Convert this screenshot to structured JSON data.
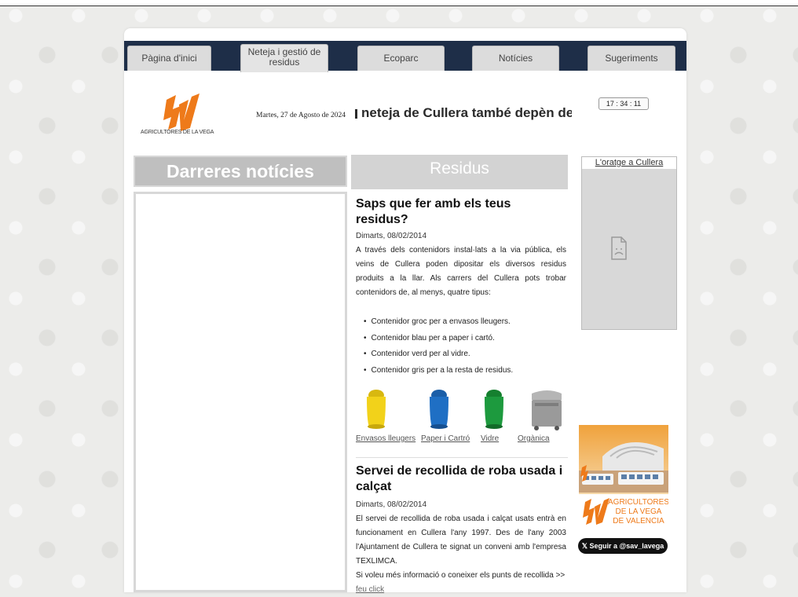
{
  "nav": {
    "tabs": [
      {
        "label": "Pàgina d'inici"
      },
      {
        "label": "Neteja i gestió de residus"
      },
      {
        "label": "Ecoparc"
      },
      {
        "label": "Notícies"
      },
      {
        "label": "Sugeriments"
      }
    ]
  },
  "header": {
    "logo_text": "AGRICULTORES DE LA VEGA",
    "date": "Martes, 27 de Agosto de 2024",
    "marquee": "neteja de  Cullera  també depèn de",
    "clock": "17 : 34 : 11"
  },
  "left": {
    "heading": "Darreres notícies"
  },
  "middle": {
    "heading": "Residus",
    "article1": {
      "title": "Saps que fer amb els teus residus?",
      "date": "Dimarts, 08/02/2014",
      "body": "A través dels contenidors  instal·lats a la via pública, els veins de Cullera poden dipositar els diversos residus produits a la llar. Als carrers del Cullera pots trobar contenidors de, al menys, quatre tipus:",
      "items": [
        "Contenidor groc per a envasos lleugers.",
        "Contenidor blau per a paper i cartó.",
        "Contenidor verd per al vidre.",
        "Contenidor gris  per a la resta de residus."
      ],
      "bin_labels": [
        "Envasos lleugers",
        "Paper i Cartró",
        "Vidre",
        "Orgànica"
      ]
    },
    "article2": {
      "title": "Servei de recollida de roba usada i calçat",
      "date": "Dimarts, 08/02/2014",
      "body": "El servei de recollida de roba usada i calçat usats entrà en funcionament en Cullera l'any 1997. Des de l'any 2003 l'Ajuntament de Cullera te signat un conveni amb l'empresa TEXLIMCA.",
      "more": "Si voleu més informació o coneixer els punts de recollida >>",
      "link": "feu click"
    }
  },
  "right": {
    "weather_link": "L'oratge a Cullera",
    "ad_text": [
      "AGRICULTORES",
      "DE LA VEGA",
      "DE VALENCIA"
    ],
    "twitter": "𝕏 Seguir a @sav_lavega"
  },
  "colors": {
    "navbar": "#1e2e48",
    "tab": "#dcdcdc",
    "logo_orange": "#ee7a1a",
    "bin_yellow": "#f2d21a",
    "bin_blue": "#1f6fc4",
    "bin_green": "#1d9a3e",
    "bin_grey": "#9a9a9a"
  }
}
